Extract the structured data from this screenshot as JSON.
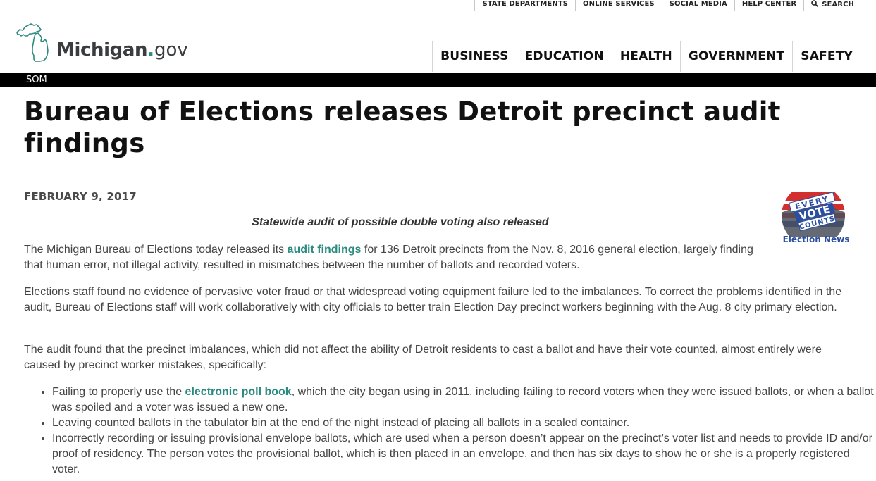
{
  "utility_nav": {
    "items": [
      "STATE DEPARTMENTS",
      "ONLINE SERVICES",
      "SOCIAL MEDIA",
      "HELP CENTER"
    ],
    "search_label": "SEARCH",
    "search_icon": "search-icon"
  },
  "logo": {
    "brand": "Michigan",
    "dot": ".",
    "suffix": "gov",
    "accent_color": "#2e8a7e"
  },
  "main_nav": {
    "items": [
      "BUSINESS",
      "EDUCATION",
      "HEALTH",
      "GOVERNMENT",
      "SAFETY"
    ]
  },
  "breadcrumb": {
    "label": "SOM"
  },
  "article": {
    "title": "Bureau of Elections releases Detroit precinct audit findings",
    "date": "FEBRUARY 9, 2017",
    "subhead": "Statewide audit of possible double voting also released",
    "p1_before": "The Michigan Bureau of Elections today released its ",
    "p1_link": "audit findings",
    "p1_after": " for 136 Detroit precincts from the Nov. 8, 2016 general election, largely finding that human error, not illegal activity, resulted in mismatches between the number of ballots and recorded voters.",
    "p2": "Elections staff found no evidence of pervasive voter fraud or that widespread voting equipment failure led to the imbalances. To correct the problems identified in the audit, Bureau of Elections staff will work collaboratively with city officials to better train Election Day precinct workers beginning with the Aug. 8 city primary election.",
    "p3": "The audit found that the precinct imbalances, which did not affect the ability of Detroit residents to cast a ballot and have their vote counted, almost entirely were caused by precinct worker mistakes, specifically:",
    "bullet1_before": "Failing to properly use the ",
    "bullet1_link": "electronic poll book",
    "bullet1_after": ", which the city began using in 2011, including failing to record voters when they were issued ballots, or when a ballot was spoiled and a voter was issued a new one.",
    "bullet2": "Leaving counted ballots in the tabulator bin at the end of the night instead of placing all ballots in a sealed container.",
    "bullet3": "Incorrectly recording or issuing provisional envelope ballots, which are used when a person doesn’t appear on the precinct’s voter list and needs to provide ID and/or proof of residency. The person votes the provisional ballot, which is then placed in an envelope, and then has six days to show he or she is a properly registered voter."
  },
  "badge": {
    "line1": "EVERY",
    "line2": "VOTE",
    "line3": "COUNTS",
    "caption": "Election News",
    "red": "#d32f2f",
    "blue": "#2b4fa0"
  }
}
